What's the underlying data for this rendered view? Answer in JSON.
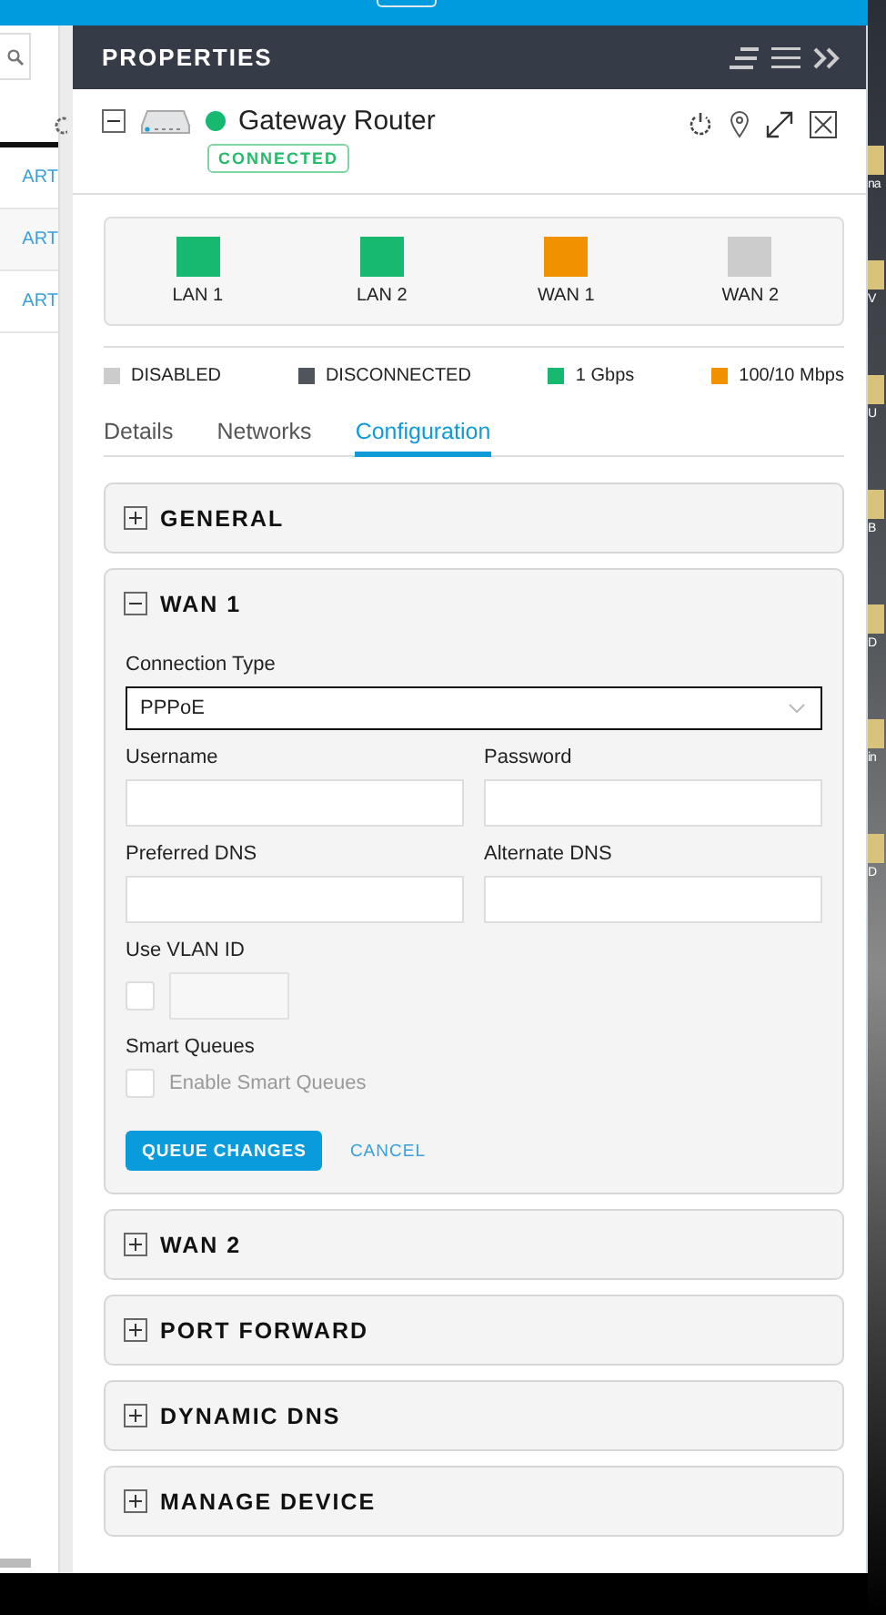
{
  "background_page": {
    "links": [
      "ART",
      "ART",
      "ART"
    ]
  },
  "panel": {
    "title": "PROPERTIES"
  },
  "device": {
    "name": "Gateway Router",
    "status": "CONNECTED",
    "online": true,
    "expanded": true
  },
  "ports": [
    {
      "label": "LAN 1",
      "color": "#16b96f"
    },
    {
      "label": "LAN 2",
      "color": "#16b96f"
    },
    {
      "label": "WAN 1",
      "color": "#f29100"
    },
    {
      "label": "WAN 2",
      "color": "#cccccc"
    }
  ],
  "legend": [
    {
      "label": "DISABLED",
      "color": "#cccccc"
    },
    {
      "label": "DISCONNECTED",
      "color": "#50555c"
    },
    {
      "label": "1 Gbps",
      "color": "#16b96f"
    },
    {
      "label": "100/10 Mbps",
      "color": "#f29100"
    }
  ],
  "tabs": [
    {
      "label": "Details",
      "selected": false
    },
    {
      "label": "Networks",
      "selected": false
    },
    {
      "label": "Configuration",
      "selected": true
    }
  ],
  "sections": [
    {
      "title": "GENERAL",
      "expanded": false
    },
    {
      "title": "WAN 1",
      "expanded": true,
      "form": {
        "connection_type": {
          "label": "Connection Type",
          "value": "PPPoE"
        },
        "fields": [
          {
            "label": "Username"
          },
          {
            "label": "Password"
          },
          {
            "label": "Preferred DNS"
          },
          {
            "label": "Alternate DNS"
          }
        ],
        "vlan": {
          "label": "Use VLAN ID",
          "checked": false
        },
        "smart_queues": {
          "label": "Smart Queues",
          "option": "Enable Smart Queues",
          "checked": false,
          "disabled": true
        },
        "buttons": {
          "primary": "QUEUE CHANGES",
          "cancel": "CANCEL"
        }
      }
    },
    {
      "title": "WAN 2",
      "expanded": false
    },
    {
      "title": "PORT FORWARD",
      "expanded": false
    },
    {
      "title": "DYNAMIC DNS",
      "expanded": false
    },
    {
      "title": "MANAGE DEVICE",
      "expanded": false
    }
  ],
  "desktop_icons": [
    {
      "label": "na"
    },
    {
      "label": "V"
    },
    {
      "label": "U"
    },
    {
      "label": "B"
    },
    {
      "label": "D"
    },
    {
      "label": "in"
    },
    {
      "label": "D"
    }
  ]
}
